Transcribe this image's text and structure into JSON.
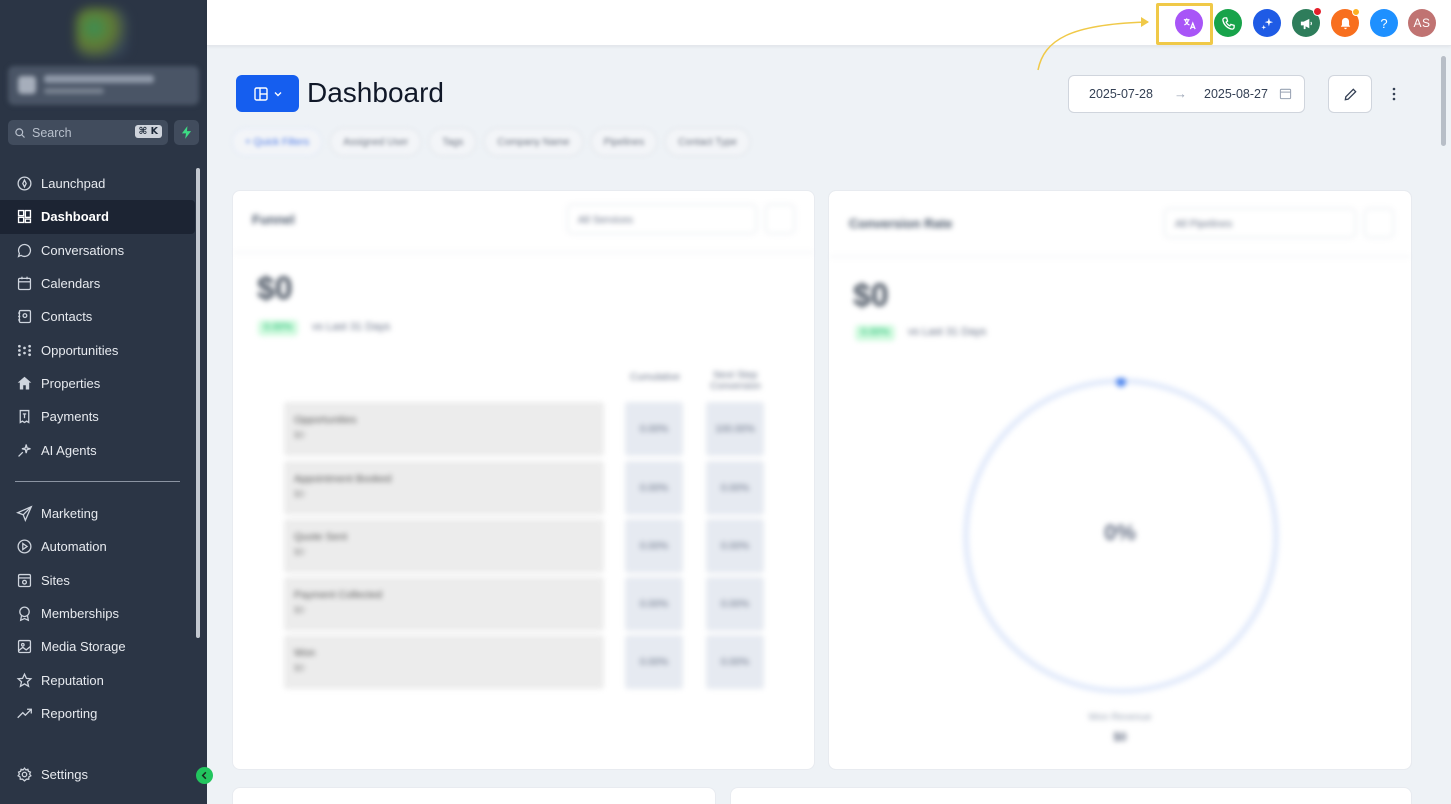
{
  "sidebar": {
    "search": {
      "placeholder": "Search",
      "shortcut": "⌘ K"
    },
    "items": [
      {
        "label": "Launchpad",
        "icon": "launchpad-icon"
      },
      {
        "label": "Dashboard",
        "icon": "dashboard-grid-icon",
        "active": true
      },
      {
        "label": "Conversations",
        "icon": "chat-bubble-icon"
      },
      {
        "label": "Calendars",
        "icon": "calendar-icon"
      },
      {
        "label": "Contacts",
        "icon": "contacts-icon"
      },
      {
        "label": "Opportunities",
        "icon": "opportunities-icon"
      },
      {
        "label": "Properties",
        "icon": "home-icon"
      },
      {
        "label": "Payments",
        "icon": "payments-icon"
      },
      {
        "label": "AI Agents",
        "icon": "sparkle-icon"
      }
    ],
    "items2": [
      {
        "label": "Marketing",
        "icon": "send-icon"
      },
      {
        "label": "Automation",
        "icon": "automation-icon"
      },
      {
        "label": "Sites",
        "icon": "sites-icon"
      },
      {
        "label": "Memberships",
        "icon": "award-icon"
      },
      {
        "label": "Media Storage",
        "icon": "image-icon"
      },
      {
        "label": "Reputation",
        "icon": "star-icon"
      },
      {
        "label": "Reporting",
        "icon": "trend-icon"
      }
    ],
    "settings": {
      "label": "Settings",
      "icon": "gear-icon"
    }
  },
  "header": {
    "avatar_initials": "AS",
    "help_label": "?",
    "icons": [
      "translate-icon",
      "phone-icon",
      "ai-sparkle-icon",
      "megaphone-icon",
      "bell-icon",
      "help-icon",
      "avatar"
    ]
  },
  "page": {
    "title": "Dashboard",
    "date_start": "2025-07-28",
    "date_arrow": "→",
    "date_end": "2025-08-27"
  },
  "filters": [
    "+ Quick Filters",
    "Assigned User",
    "Tags",
    "Company Name",
    "Pipelines",
    "Contact Type"
  ],
  "funnel_card": {
    "title": "Funnel",
    "select": "All Services",
    "value": "$0",
    "badge": "0.00%",
    "note": "vs Last 31 Days",
    "col1": "Cumulative",
    "col2": "Next Step Conversion",
    "rows": [
      {
        "label": "Opportunities",
        "sub": "$0",
        "c1": "0.00%",
        "c2": "100.00%"
      },
      {
        "label": "Appointment Booked",
        "sub": "$0",
        "c1": "0.00%",
        "c2": "0.00%"
      },
      {
        "label": "Quote Sent",
        "sub": "$0",
        "c1": "0.00%",
        "c2": "0.00%"
      },
      {
        "label": "Payment Collected",
        "sub": "$0",
        "c1": "0.00%",
        "c2": "0.00%"
      },
      {
        "label": "Won",
        "sub": "$0",
        "c1": "0.00%",
        "c2": "0.00%"
      }
    ]
  },
  "conversion_card": {
    "title": "Conversion Rate",
    "select": "All Pipelines",
    "value": "$0",
    "badge": "0.00%",
    "note": "vs Last 31 Days",
    "center": "0%",
    "foot_label": "Won Revenue",
    "foot_value": "$0"
  },
  "colors": {
    "primary": "#155eef",
    "sidebar": "#2b3545",
    "highlight": "#f0c948"
  }
}
